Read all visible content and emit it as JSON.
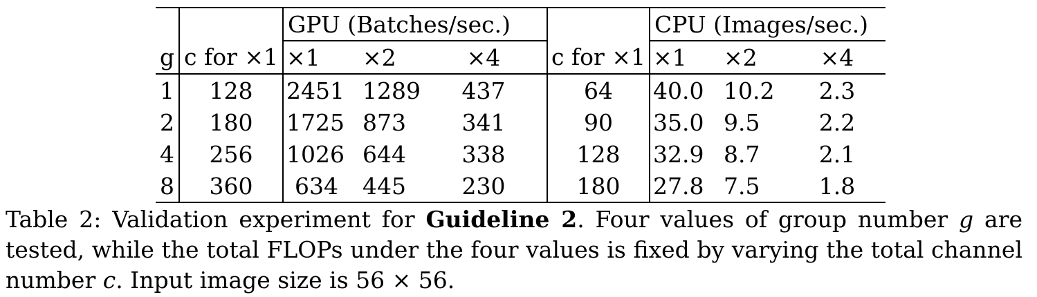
{
  "table": {
    "group_header_gpu": "GPU (Batches/sec.)",
    "group_header_cpu": "CPU (Images/sec.)",
    "col_g": "g",
    "col_c_gpu": "c for ×1",
    "col_gpu_x1": "×1",
    "col_gpu_x2": "×2",
    "col_gpu_x4": "×4",
    "col_c_cpu": "c for ×1",
    "col_cpu_x1": "×1",
    "col_cpu_x2": "×2",
    "col_cpu_x4": "×4",
    "rows": [
      {
        "g": "1",
        "c_gpu": "128",
        "gpu_x1": "2451",
        "gpu_x2": "1289",
        "gpu_x4": "437",
        "c_cpu": "64",
        "cpu_x1": "40.0",
        "cpu_x2": "10.2",
        "cpu_x4": "2.3"
      },
      {
        "g": "2",
        "c_gpu": "180",
        "gpu_x1": "1725",
        "gpu_x2": "873",
        "gpu_x4": "341",
        "c_cpu": "90",
        "cpu_x1": "35.0",
        "cpu_x2": "9.5",
        "cpu_x4": "2.2"
      },
      {
        "g": "4",
        "c_gpu": "256",
        "gpu_x1": "1026",
        "gpu_x2": "644",
        "gpu_x4": "338",
        "c_cpu": "128",
        "cpu_x1": "32.9",
        "cpu_x2": "8.7",
        "cpu_x4": "2.1"
      },
      {
        "g": "8",
        "c_gpu": "360",
        "gpu_x1": "634",
        "gpu_x2": "445",
        "gpu_x4": "230",
        "c_cpu": "180",
        "cpu_x1": "27.8",
        "cpu_x2": "7.5",
        "cpu_x4": "1.8"
      }
    ]
  },
  "caption": {
    "prefix": "Table 2: Validation experiment for ",
    "bold": "Guideline 2",
    "mid1": ". Four values of group number ",
    "var_g": "g",
    "mid2": " are tested, while the total FLOPs under the four values is fixed by varying the total channel number ",
    "var_c": "c",
    "suffix": ". Input image size is 56 × 56."
  }
}
